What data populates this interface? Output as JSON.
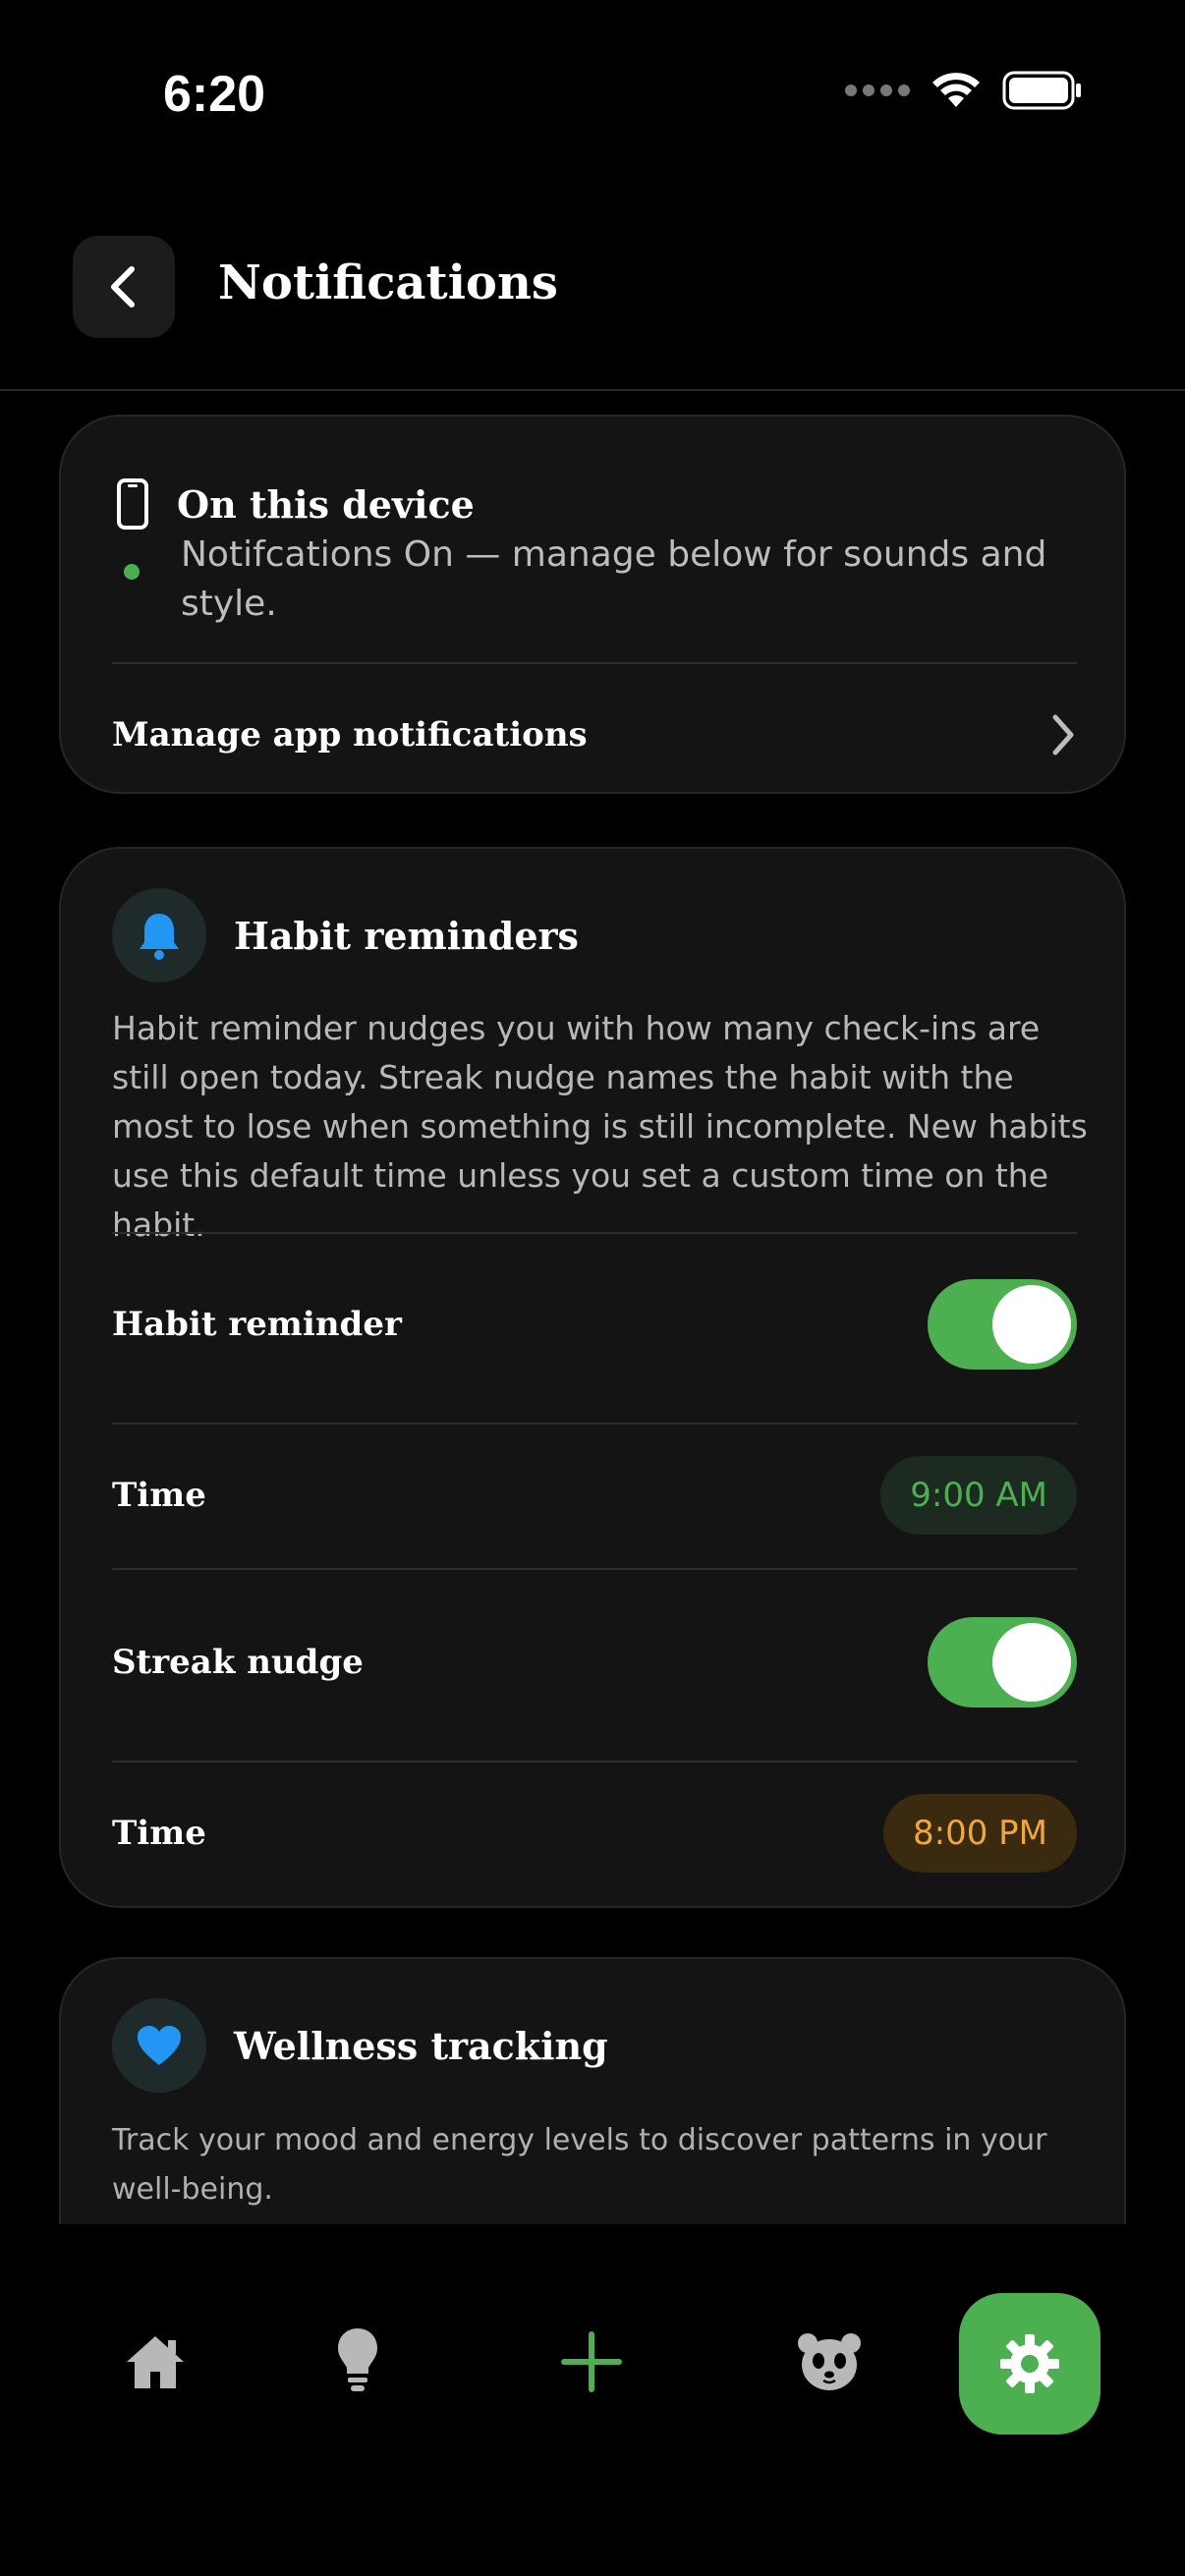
{
  "status_bar": {
    "time": "6:20"
  },
  "header": {
    "title": "Notifications"
  },
  "device_card": {
    "title": "On this device",
    "status_text": "Notifcations On — manage below for sounds and style.",
    "manage_label": "Manage app notifications"
  },
  "habit_card": {
    "title": "Habit reminders",
    "description": "Habit reminder nudges you with how many check-ins are still open today. Streak nudge names the habit with the most to lose when something is still incomplete. New habits use this default time unless you set a custom time on the habit.",
    "habit_reminder_label": "Habit reminder",
    "habit_reminder_on": true,
    "time_label_1": "Time",
    "time_value_1": "9:00 AM",
    "streak_nudge_label": "Streak nudge",
    "streak_nudge_on": true,
    "time_label_2": "Time",
    "time_value_2": "8:00 PM"
  },
  "wellness_card": {
    "title": "Wellness tracking",
    "description": "Track your mood and energy levels to discover patterns in your well-being."
  },
  "bottom_nav": {
    "items": [
      "home-icon",
      "lightbulb-icon",
      "plus-icon",
      "panda-icon",
      "gear-icon"
    ],
    "active": "gear-icon"
  },
  "colors": {
    "accent_green": "#4caf50",
    "accent_orange": "#f0a83a",
    "accent_blue": "#2196f3"
  }
}
